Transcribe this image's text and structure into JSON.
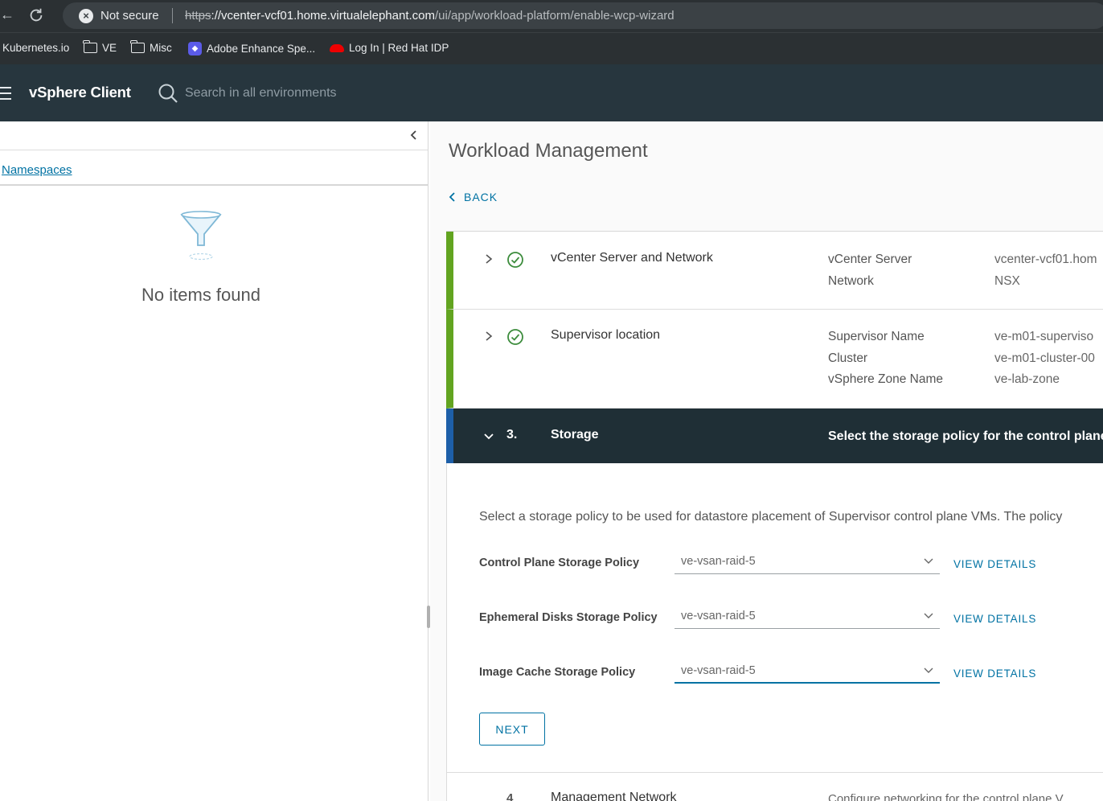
{
  "browser": {
    "security_label": "Not secure",
    "url_scheme": "https",
    "url_host": "://vcenter-vcf01.home.virtualelephant.com",
    "url_path": "/ui/app/workload-platform/enable-wcp-wizard",
    "bookmarks": [
      {
        "label": "Kubernetes.io",
        "icon": "none"
      },
      {
        "label": "VE",
        "icon": "folder-icon"
      },
      {
        "label": "Misc",
        "icon": "folder-icon"
      },
      {
        "label": "Adobe Enhance Spe...",
        "icon": "adobe-icon"
      },
      {
        "label": "Log In | Red Hat IDP",
        "icon": "redhat-icon"
      }
    ]
  },
  "header": {
    "app_title": "vSphere Client",
    "search_placeholder": "Search in all environments"
  },
  "sidebar": {
    "link_label": "Namespaces",
    "empty_text": "No items found"
  },
  "main": {
    "page_title": "Workload Management",
    "back_label": "BACK",
    "steps": [
      {
        "name": "vCenter Server and Network",
        "status": "complete",
        "details": [
          {
            "key": "vCenter Server",
            "value": "vcenter-vcf01.hom"
          },
          {
            "key": "Network",
            "value": "NSX"
          }
        ]
      },
      {
        "name": "Supervisor location",
        "status": "complete",
        "details": [
          {
            "key": "Supervisor Name",
            "value": "ve-m01-superviso"
          },
          {
            "key": "Cluster",
            "value": "ve-m01-cluster-00"
          },
          {
            "key": "vSphere Zone Name",
            "value": "ve-lab-zone"
          }
        ]
      },
      {
        "number": "3.",
        "name": "Storage",
        "description": "Select the storage policy for the control plane",
        "intro": "Select a storage policy to be used for datastore placement of Supervisor control plane VMs. The policy",
        "policies": [
          {
            "label": "Control Plane Storage Policy",
            "value": "ve-vsan-raid-5",
            "action": "VIEW DETAILS"
          },
          {
            "label": "Ephemeral Disks Storage Policy",
            "value": "ve-vsan-raid-5",
            "action": "VIEW DETAILS"
          },
          {
            "label": "Image Cache Storage Policy",
            "value": "ve-vsan-raid-5",
            "action": "VIEW DETAILS"
          }
        ],
        "next_label": "NEXT"
      },
      {
        "number": "4",
        "name": "Management Network",
        "description": "Configure networking for the control plane V"
      }
    ]
  },
  "colors": {
    "header_bg": "#27363e",
    "active_step_bg": "#1f2f36",
    "complete_accent": "#62a420",
    "active_accent": "#1d5fa8",
    "link": "#0072a3"
  }
}
